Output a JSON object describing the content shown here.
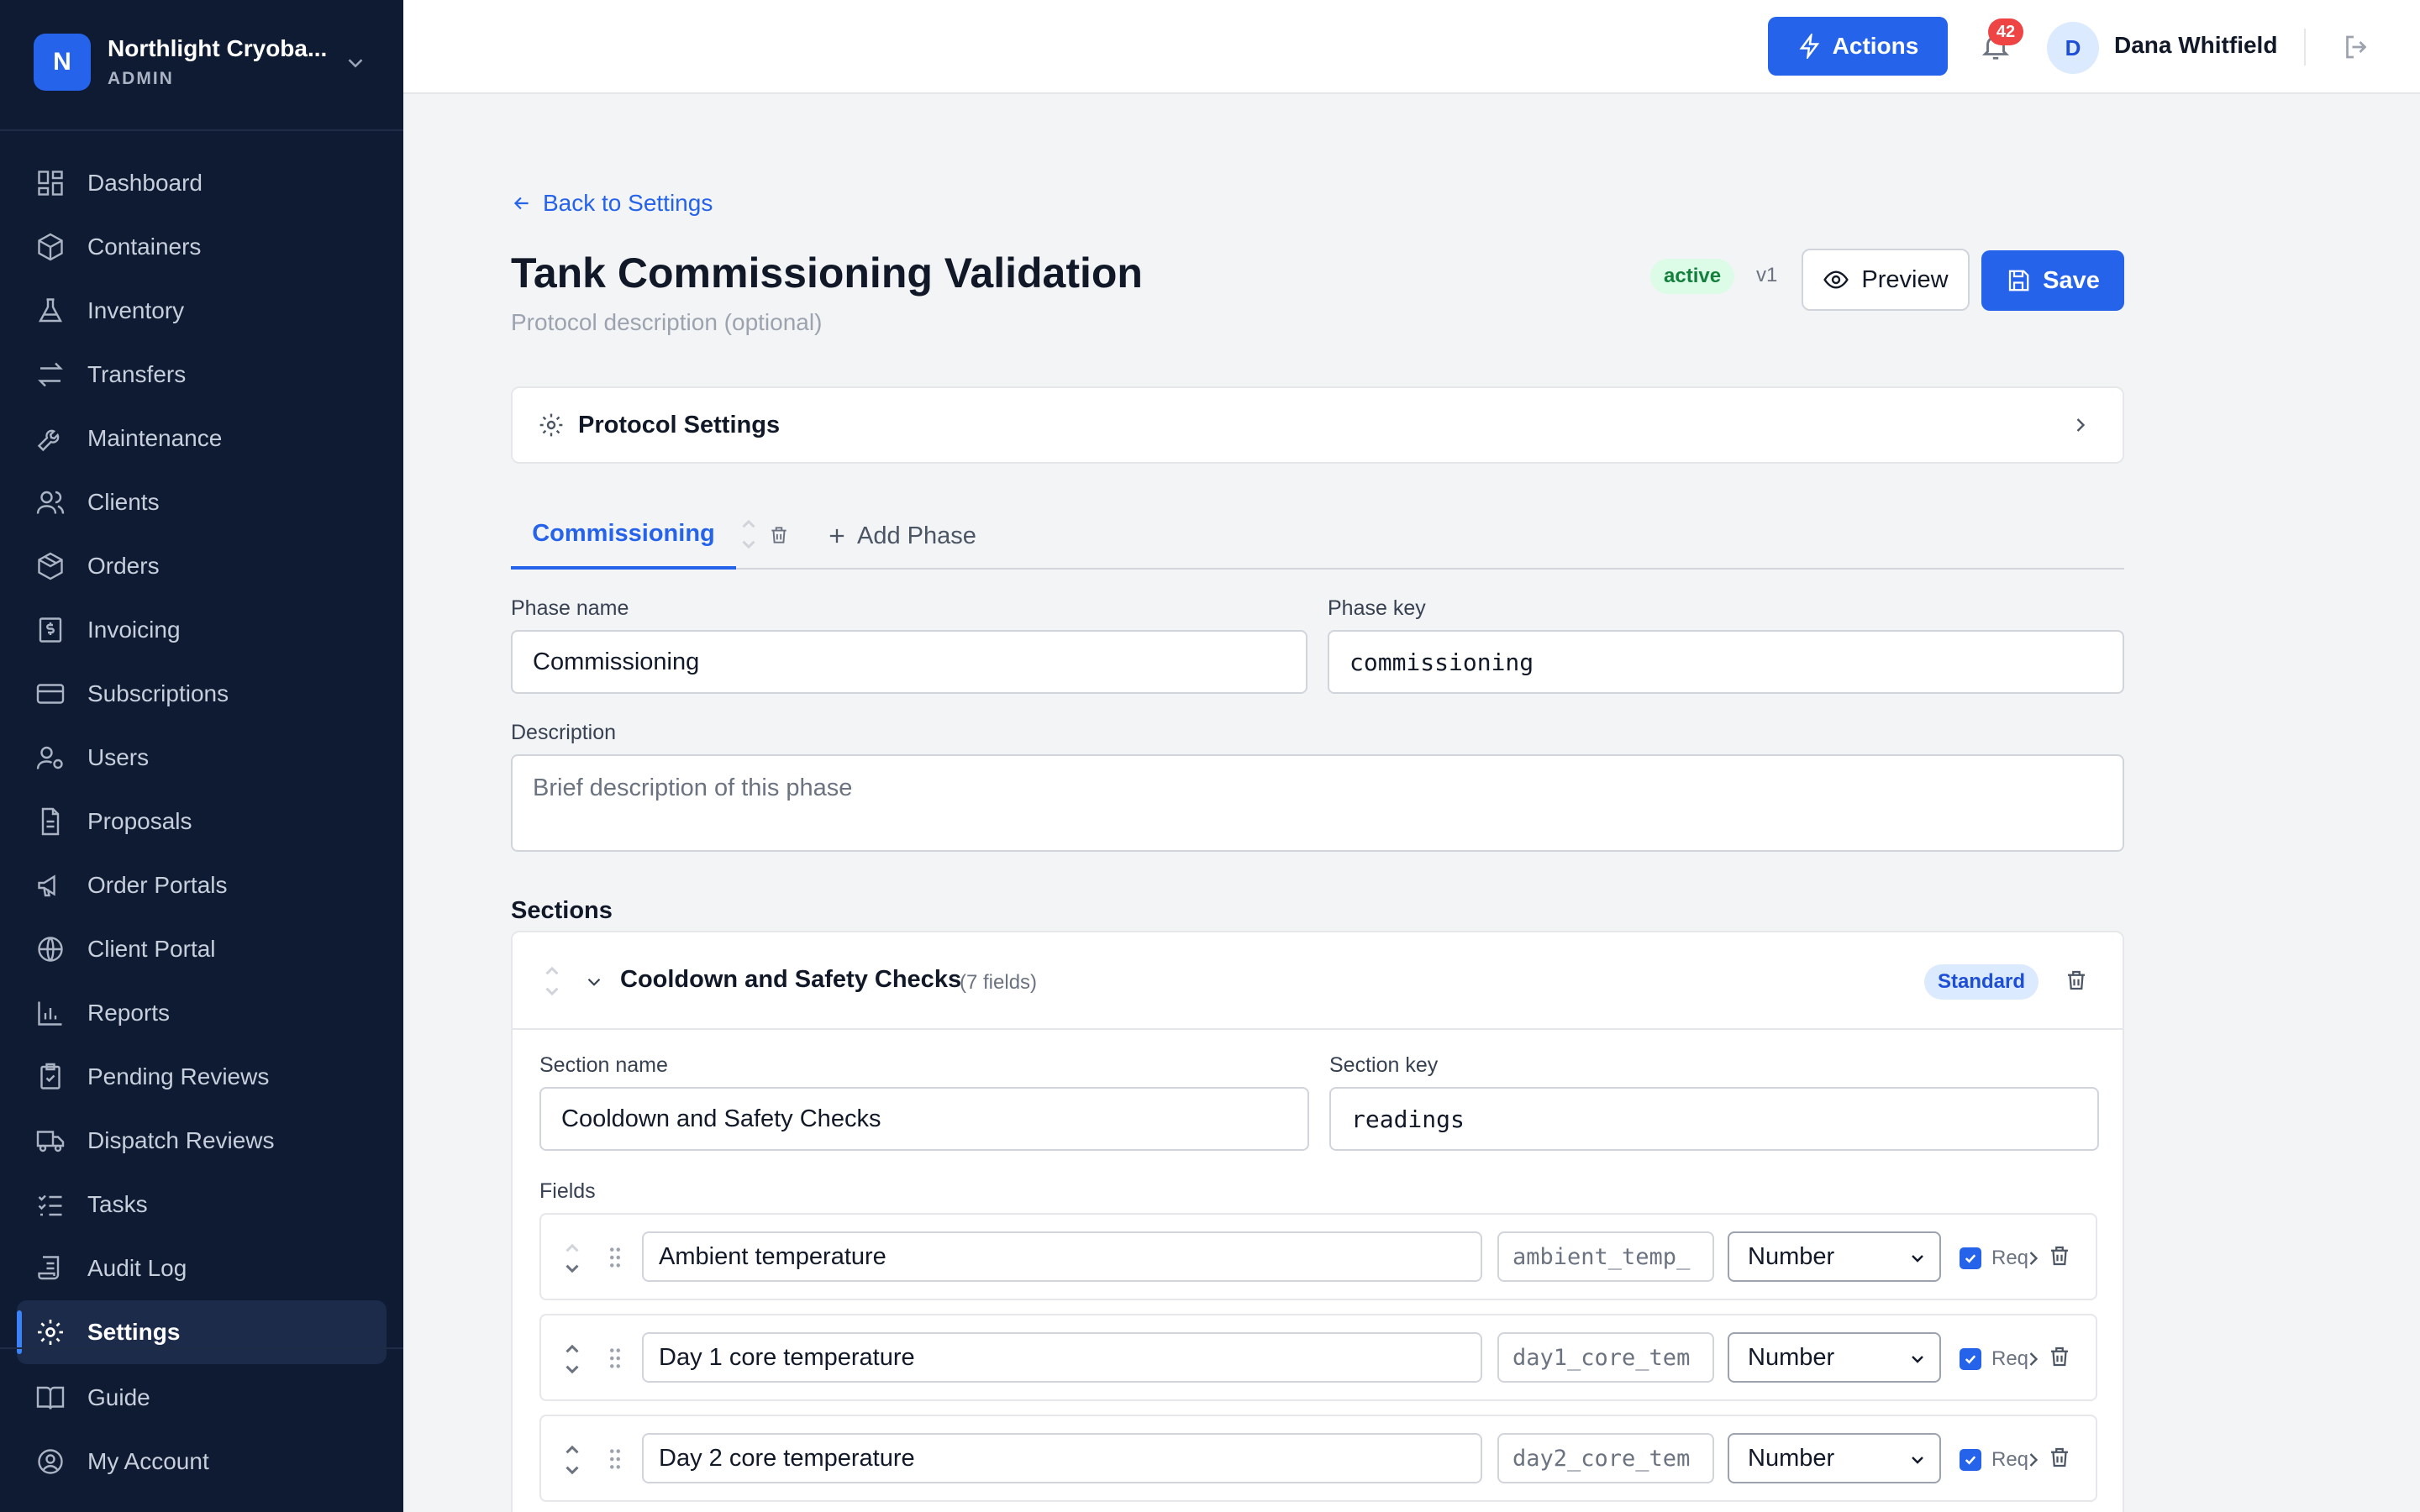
{
  "org": {
    "avatar_letter": "N",
    "name": "Northlight Cryoba...",
    "role": "ADMIN"
  },
  "nav": {
    "items": [
      {
        "label": "Dashboard",
        "icon": "dashboard-icon"
      },
      {
        "label": "Containers",
        "icon": "cube-icon"
      },
      {
        "label": "Inventory",
        "icon": "flask-icon"
      },
      {
        "label": "Transfers",
        "icon": "arrows-icon"
      },
      {
        "label": "Maintenance",
        "icon": "wrench-icon"
      },
      {
        "label": "Clients",
        "icon": "users-icon"
      },
      {
        "label": "Orders",
        "icon": "package-icon"
      },
      {
        "label": "Invoicing",
        "icon": "invoice-icon"
      },
      {
        "label": "Subscriptions",
        "icon": "card-icon"
      },
      {
        "label": "Users",
        "icon": "user-cog-icon"
      },
      {
        "label": "Proposals",
        "icon": "document-icon"
      },
      {
        "label": "Order Portals",
        "icon": "megaphone-icon"
      },
      {
        "label": "Client Portal",
        "icon": "globe-icon"
      },
      {
        "label": "Reports",
        "icon": "bar-chart-icon"
      },
      {
        "label": "Pending Reviews",
        "icon": "clipboard-check-icon"
      },
      {
        "label": "Dispatch Reviews",
        "icon": "truck-icon"
      },
      {
        "label": "Tasks",
        "icon": "list-check-icon"
      },
      {
        "label": "Audit Log",
        "icon": "scroll-icon"
      },
      {
        "label": "Settings",
        "icon": "gear-icon",
        "active": true
      }
    ],
    "bottom": [
      {
        "label": "Guide",
        "icon": "book-icon"
      },
      {
        "label": "My Account",
        "icon": "user-circle-icon"
      }
    ]
  },
  "topbar": {
    "actions_label": "Actions",
    "notifications_count": "42",
    "user_initial": "D",
    "user_name": "Dana Whitfield"
  },
  "page": {
    "back_label": "Back to Settings",
    "title": "Tank Commissioning Validation",
    "description_placeholder": "Protocol description (optional)",
    "status": "active",
    "version": "v1",
    "preview_label": "Preview",
    "save_label": "Save",
    "protocol_settings_label": "Protocol Settings"
  },
  "phases": {
    "tabs": [
      "Commissioning"
    ],
    "add_label": "Add Phase",
    "phase_name_label": "Phase name",
    "phase_name_value": "Commissioning",
    "phase_key_label": "Phase key",
    "phase_key_value": "commissioning",
    "description_label": "Description",
    "description_placeholder": "Brief description of this phase"
  },
  "sections": {
    "title": "Sections",
    "items": [
      {
        "name": "Cooldown and Safety Checks",
        "count": "(7 fields)",
        "badge": "Standard",
        "section_name_label": "Section name",
        "section_name_value": "Cooldown and Safety Checks",
        "section_key_label": "Section key",
        "section_key_value": "readings",
        "fields_label": "Fields",
        "fields": [
          {
            "label": "Ambient temperature",
            "key": "ambient_temp_",
            "type": "Number",
            "req": "Req"
          },
          {
            "label": "Day 1 core temperature",
            "key": "day1_core_tem",
            "type": "Number",
            "req": "Req"
          },
          {
            "label": "Day 2 core temperature",
            "key": "day2_core_tem",
            "type": "Number",
            "req": "Req"
          }
        ]
      }
    ]
  },
  "colors": {
    "sidebar": "#0f1b33",
    "primary": "#2563eb",
    "success_bg": "#dcfce7",
    "danger": "#ef4444"
  }
}
